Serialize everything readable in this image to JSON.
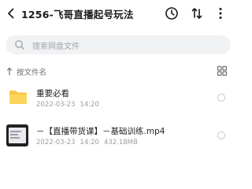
{
  "header": {
    "title": "1256-飞哥直播起号玩法"
  },
  "search": {
    "placeholder": "搜索网盘文件"
  },
  "sort": {
    "label": "按文件名"
  },
  "files": [
    {
      "name": "重要必看",
      "date": "2022-03-23",
      "time": "14:20",
      "size": "",
      "type": "folder",
      "icon": "folder-icon",
      "color": "#f7c843"
    },
    {
      "name": "－【直播带货课】－基础训练.mp4",
      "date": "2022-03-23",
      "time": "14:20",
      "size": "432.18MB",
      "type": "video",
      "icon": "video-thumbnail"
    }
  ]
}
